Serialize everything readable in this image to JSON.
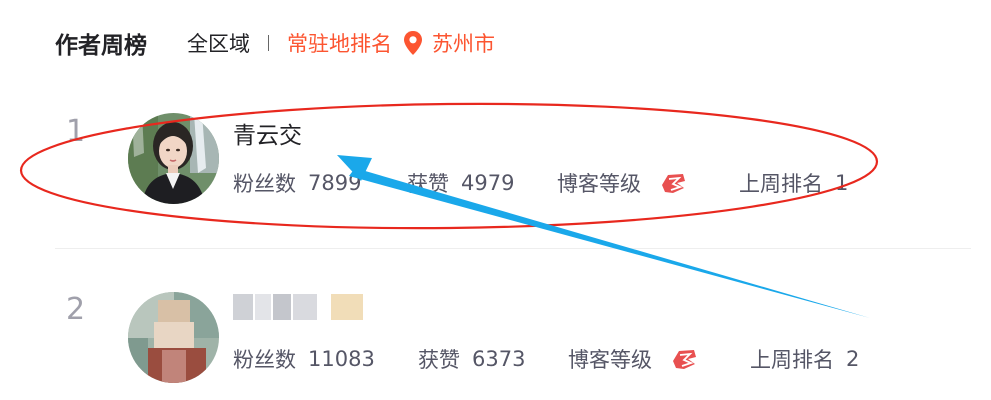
{
  "header": {
    "title": "作者周榜",
    "region": "全区域",
    "resident_label": "常驻地排名",
    "city": "苏州市"
  },
  "ranking": [
    {
      "rank": "1",
      "name": "青云交",
      "fans_label": "粉丝数",
      "fans": "7899",
      "likes_label": "获赞",
      "likes": "4979",
      "level_label": "博客等级",
      "last_week_label": "上周排名",
      "last_week": "1"
    },
    {
      "rank": "2",
      "name": "",
      "fans_label": "粉丝数",
      "fans": "11083",
      "likes_label": "获赞",
      "likes": "6373",
      "level_label": "博客等级",
      "last_week_label": "上周排名",
      "last_week": "2"
    }
  ],
  "colors": {
    "accent": "#fc5531",
    "annotation_ellipse": "#e8281e",
    "annotation_arrow": "#1aa8ea"
  },
  "icons": {
    "location": "map-pin-icon",
    "level": "blog-level-icon"
  }
}
